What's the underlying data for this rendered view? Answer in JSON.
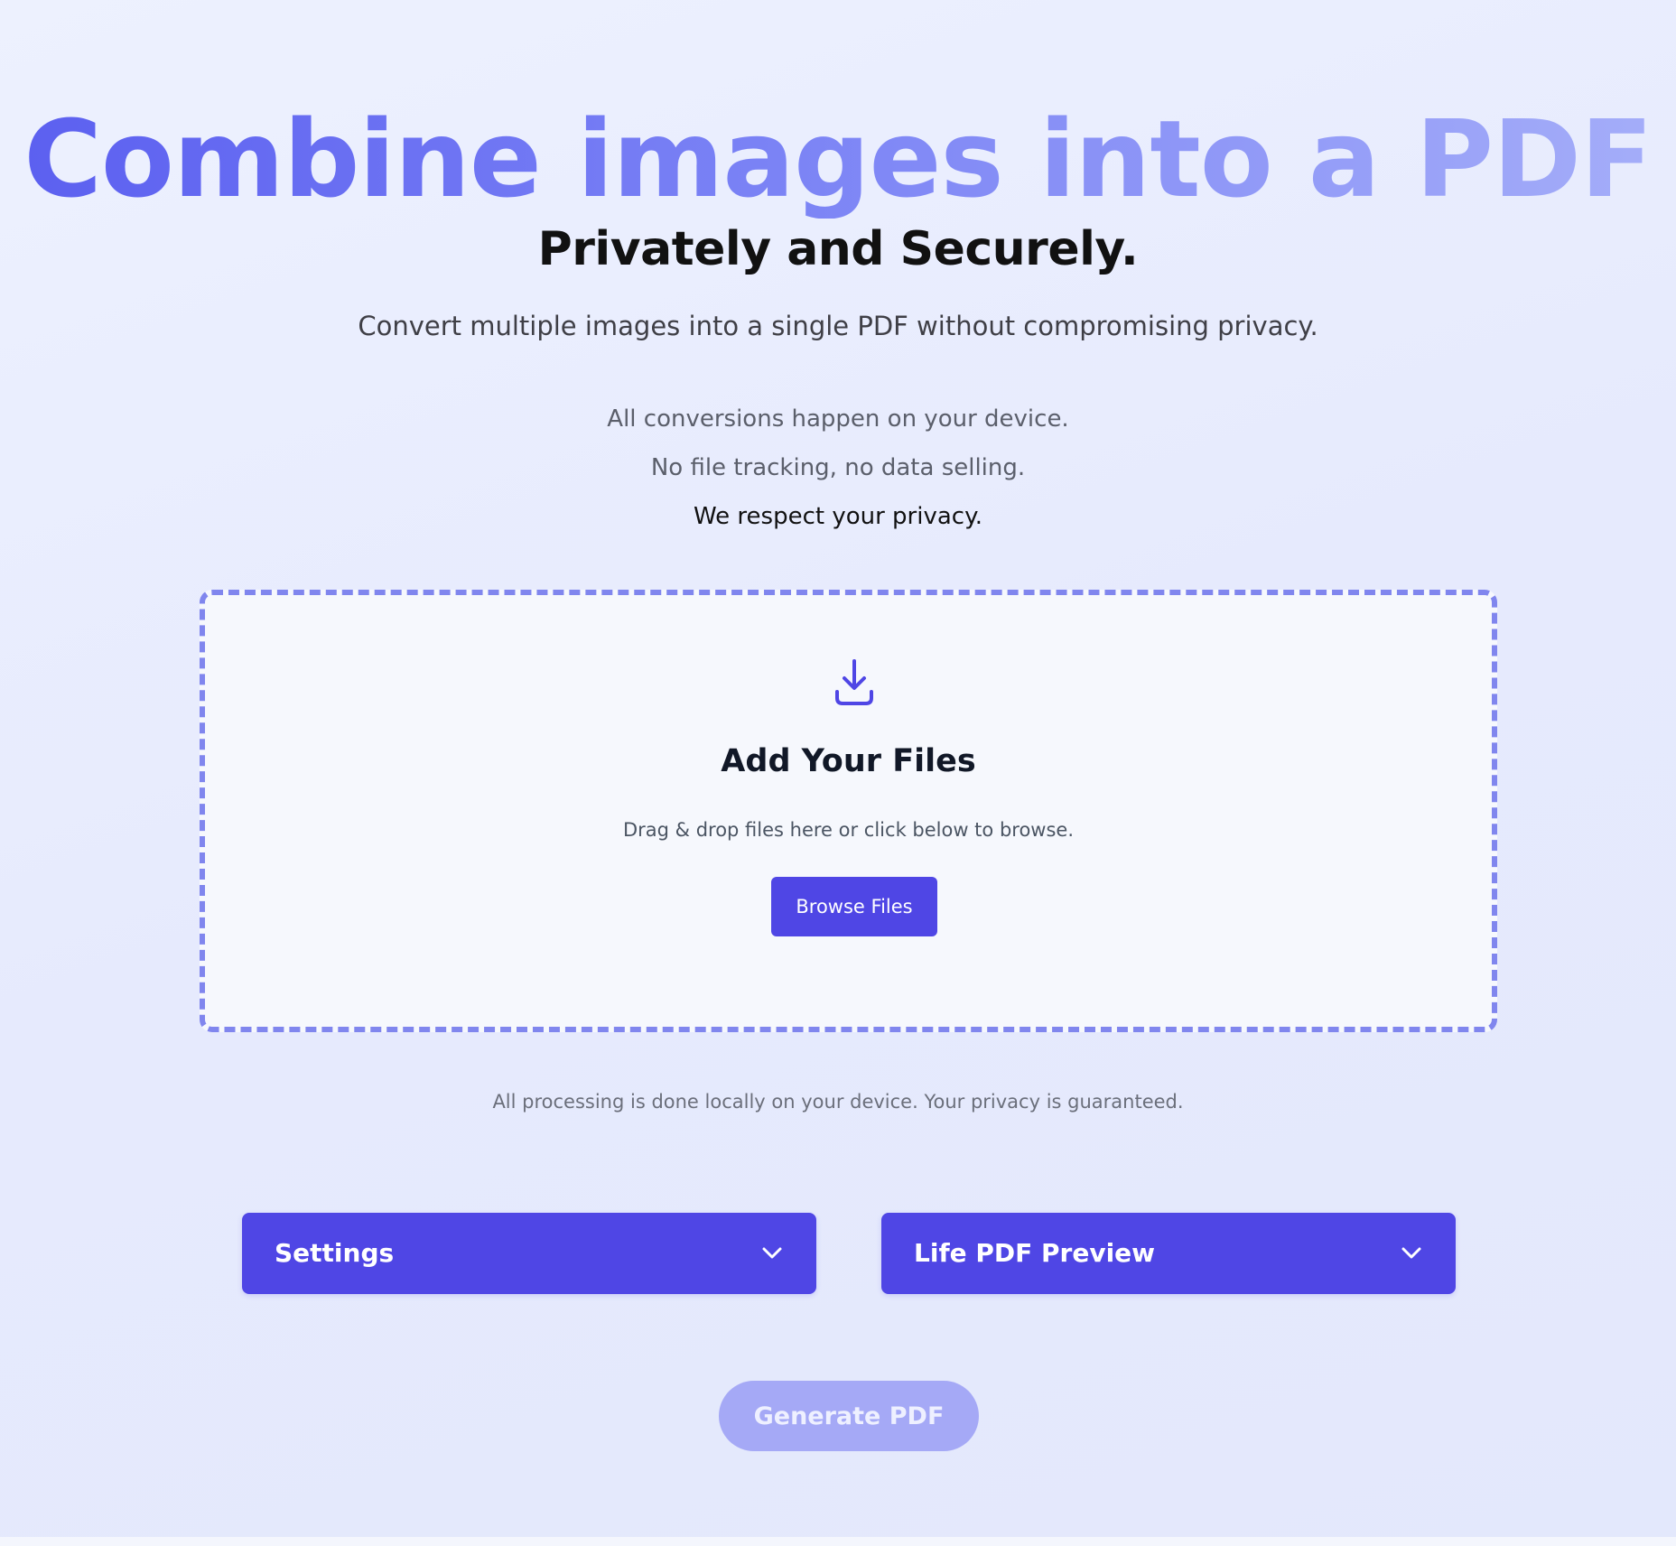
{
  "hero": {
    "title_words": [
      "Combine",
      "images",
      "into",
      "a",
      "PDF"
    ],
    "subtitle": "Privately and Securely.",
    "description": "Convert multiple images into a single PDF without compromising privacy."
  },
  "privacy": {
    "line1": "All conversions happen on your device.",
    "line2": "No file tracking, no data selling.",
    "line3": "We respect your privacy."
  },
  "dropzone": {
    "icon": "download-icon",
    "title": "Add Your Files",
    "hint": "Drag & drop files here or click below to browse.",
    "browse_label": "Browse Files"
  },
  "local_note": "All processing is done locally on your device. Your privacy is guaranteed.",
  "panels": {
    "settings_label": "Settings",
    "preview_label": "Life PDF Preview",
    "chevron_icon": "chevron-down-icon"
  },
  "actions": {
    "generate_label": "Generate PDF"
  },
  "colors": {
    "primary": "#4f46e5",
    "gradient_start": "#5b5ff0",
    "gradient_end": "#a5aef9",
    "dropzone_border": "#8086ee",
    "generate_disabled": "#a5a9f6"
  }
}
